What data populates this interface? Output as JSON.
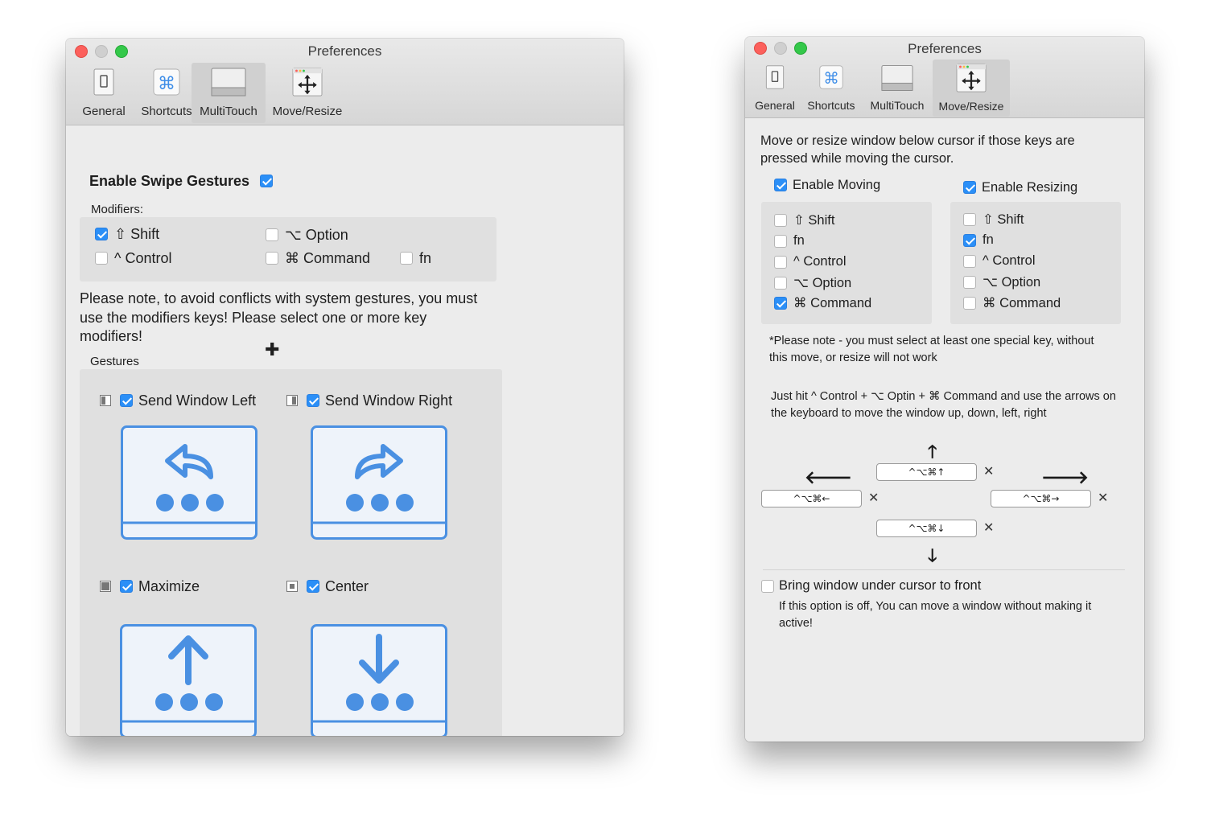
{
  "win1": {
    "title": "Preferences",
    "tabs": [
      {
        "label": "General",
        "icon": "general-icon"
      },
      {
        "label": "Shortcuts",
        "icon": "command-key-icon"
      },
      {
        "label": "MultiTouch",
        "icon": "trackpad-icon"
      },
      {
        "label": "Move/Resize",
        "icon": "move-arrows-icon"
      }
    ],
    "selected_tab": "MultiTouch",
    "enable_swipe": {
      "label": "Enable Swipe Gestures",
      "checked": true
    },
    "modifiers_label": "Modifiers:",
    "modifiers": [
      {
        "label": "⇧ Shift",
        "checked": true
      },
      {
        "label": "⌥ Option",
        "checked": false
      },
      {
        "label": "^ Control",
        "checked": false
      },
      {
        "label": "⌘ Command",
        "checked": false
      },
      {
        "label": "fn",
        "checked": false
      }
    ],
    "note": "Please note, to avoid conflicts with system gestures, you must use the modifiers keys! Please select one or more key modifiers!",
    "gestures_label": "Gestures",
    "gestures": [
      {
        "label": "Send Window Left",
        "checked": true,
        "icon": "swipe-left-icon"
      },
      {
        "label": "Send Window Right",
        "checked": true,
        "icon": "swipe-right-icon"
      },
      {
        "label": "Maximize",
        "checked": true,
        "icon": "swipe-up-icon"
      },
      {
        "label": "Center",
        "checked": true,
        "icon": "swipe-down-icon"
      }
    ]
  },
  "win2": {
    "title": "Preferences",
    "tabs": [
      {
        "label": "General",
        "icon": "general-icon"
      },
      {
        "label": "Shortcuts",
        "icon": "command-key-icon"
      },
      {
        "label": "MultiTouch",
        "icon": "trackpad-icon"
      },
      {
        "label": "Move/Resize",
        "icon": "move-arrows-icon"
      }
    ],
    "selected_tab": "Move/Resize",
    "intro": "Move or resize window below cursor if those keys are pressed while moving the cursor.",
    "enable_moving": {
      "label": "Enable Moving",
      "checked": true
    },
    "enable_resizing": {
      "label": "Enable Resizing",
      "checked": true
    },
    "moving_keys": [
      {
        "label": "⇧ Shift",
        "checked": false
      },
      {
        "label": "fn",
        "checked": false
      },
      {
        "label": "^ Control",
        "checked": false
      },
      {
        "label": "⌥ Option",
        "checked": false
      },
      {
        "label": "⌘ Command",
        "checked": true
      }
    ],
    "resizing_keys": [
      {
        "label": "⇧ Shift",
        "checked": false
      },
      {
        "label": "fn",
        "checked": true
      },
      {
        "label": "^ Control",
        "checked": false
      },
      {
        "label": "⌥ Option",
        "checked": false
      },
      {
        "label": "⌘ Command",
        "checked": false
      }
    ],
    "special_note": "*Please note - you must select at least one special key, without this move, or resize will not work",
    "hint": "Just hit  ^ Control  + ⌥ Optin + ⌘ Command and use the arrows on the keyboard to move the window up, down, left, right",
    "shortcuts": {
      "up": "^⌥⌘↑",
      "left": "^⌥⌘←",
      "right": "^⌥⌘→",
      "down": "^⌥⌘↓"
    },
    "arrows": {
      "up": "🡑",
      "left": "🡐",
      "right": "🡒",
      "down": "🡓"
    },
    "clear_glyph": "✕",
    "bring_front": {
      "label": "Bring window under cursor to front",
      "checked": false
    },
    "bring_front_note": "If this option is off, You can move a window without making it active!"
  },
  "cursor_glyph": "✚",
  "colors": {
    "accent": "#2b8ff7",
    "gesture_blue": "#4a90e2",
    "tab_selected": "#d0d0d0"
  }
}
